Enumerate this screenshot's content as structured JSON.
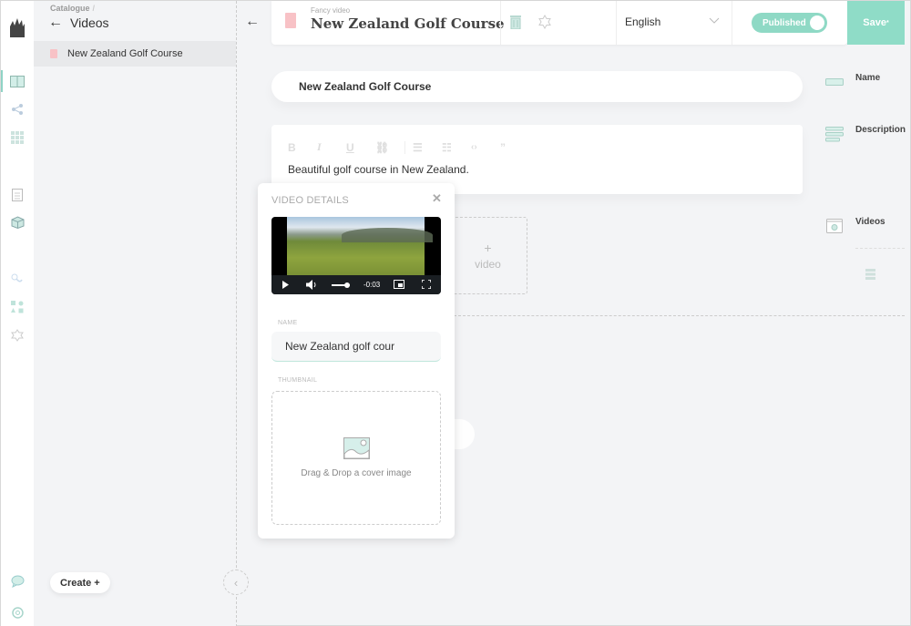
{
  "nav": {
    "breadcrumb": "Catalogue",
    "breadcrumb_sep": "/",
    "title": "Videos",
    "items": [
      {
        "label": "New Zealand Golf Course"
      }
    ],
    "create_label": "Create +"
  },
  "rail": {
    "icons": [
      "catalogue-book-icon",
      "topics-tree-icon",
      "grid-icon",
      "orders-clipboard-icon",
      "products-box-icon",
      "webhooks-icon",
      "apps-icon",
      "settings-icon",
      "support-chat-icon",
      "user-settings-icon"
    ],
    "active": "catalogue-book-icon",
    "accent": "#8fd3c5"
  },
  "header": {
    "doc_type": "Fancy video",
    "doc_title": "New Zealand Golf Course",
    "language": "English",
    "status_label": "Published",
    "status_on": true,
    "save_label": "Save",
    "save_marker": "*",
    "accent": "#8fdcc7"
  },
  "content": {
    "name_value": "New Zealand Golf Course",
    "description_value": "Beautiful golf course in New Zealand.",
    "toolbar": [
      "B",
      "I",
      "U",
      "link",
      "bulleted-list",
      "numbered-list",
      "code",
      "quote"
    ],
    "add_video_plus": "+",
    "add_video_label": "video"
  },
  "legend": {
    "items": [
      {
        "label": "Name",
        "icon": "single-line-icon"
      },
      {
        "label": "Description",
        "icon": "rich-text-icon"
      },
      {
        "label": "Videos",
        "icon": "video-icon"
      }
    ]
  },
  "popover": {
    "title": "VIDEO DETAILS",
    "close": "✕",
    "player_time": "-0:03",
    "volume_fraction": 0.7,
    "name_label": "NAME",
    "name_value": "New Zealand golf cour",
    "thumbnail_label": "THUMBNAIL",
    "drop_text": "Drag & Drop a cover image"
  }
}
